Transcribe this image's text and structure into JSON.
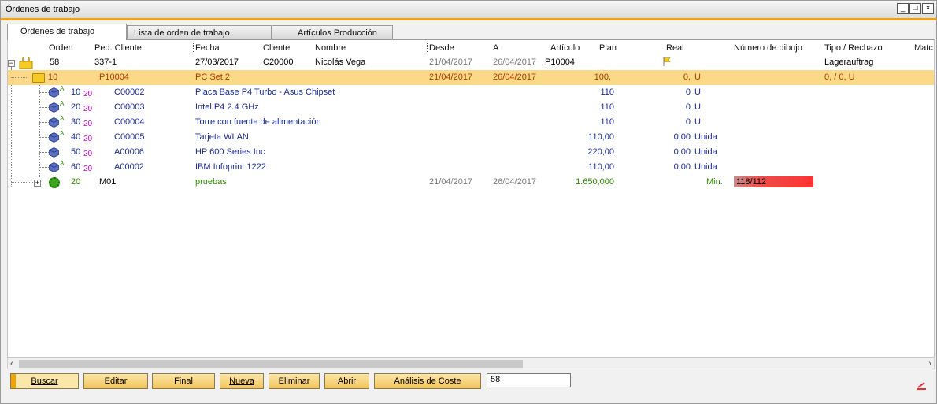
{
  "window": {
    "title": "Órdenes de trabajo",
    "minimize_icon": "minimize-icon",
    "maximize_icon": "maximize-icon",
    "close_icon": "close-icon"
  },
  "tabs": [
    {
      "label": "Órdenes de trabajo",
      "active": true
    },
    {
      "label": "Lista de orden de trabajo",
      "active": false
    },
    {
      "label": "Artículos Producción",
      "active": false
    }
  ],
  "columns": {
    "orden": "Orden",
    "ped_cliente": "Ped. Cliente",
    "fecha": "Fecha",
    "cliente": "Cliente",
    "nombre": "Nombre",
    "desde": "Desde",
    "a": "A",
    "articulo": "Artículo",
    "plan": "Plan",
    "real": "Real",
    "numero_dibujo": "Número de dibujo",
    "tipo_rechazo": "Tipo / Rechazo",
    "matc": "Matc"
  },
  "rows": [
    {
      "orden": "58",
      "ped_cliente": "337-1",
      "fecha": "27/03/2017",
      "cliente": "C20000",
      "nombre": "Nicolás Vega",
      "desde": "21/04/2017",
      "a": "26/04/2017",
      "articulo": "P10004",
      "tipo": "Lagerauftrag",
      "icon": "lock-folder-icon",
      "real_icon": "flag-icon"
    },
    {
      "orden": "10",
      "ped_cliente": "P10004",
      "fecha": "PC Set 2",
      "desde": "21/04/2017",
      "a": "26/04/2017",
      "plan": "100,",
      "real": "0,",
      "unit": "U",
      "tipo": "0, / 0, U",
      "icon": "folder-icon"
    },
    {
      "orden": "10",
      "sub": "20",
      "ped_cliente": "C00002",
      "fecha": "Placa Base P4 Turbo - Asus Chipset",
      "plan": "110",
      "real": "0",
      "unit": "U",
      "icon": "item-cube-icon",
      "marker": "A"
    },
    {
      "orden": "20",
      "sub": "20",
      "ped_cliente": "C00003",
      "fecha": "Intel P4 2.4 GHz",
      "plan": "110",
      "real": "0",
      "unit": "U",
      "icon": "item-cube-icon",
      "marker": "A"
    },
    {
      "orden": "30",
      "sub": "20",
      "ped_cliente": "C00004",
      "fecha": "Torre con fuente de alimentación",
      "plan": "110",
      "real": "0",
      "unit": "U",
      "icon": "item-cube-icon",
      "marker": "A"
    },
    {
      "orden": "40",
      "sub": "20",
      "ped_cliente": "C00005",
      "fecha": "Tarjeta WLAN",
      "plan": "110,00",
      "real": "0,00",
      "unit": "Unida",
      "icon": "item-cube-icon",
      "marker": "A"
    },
    {
      "orden": "50",
      "sub": "20",
      "ped_cliente": "A00006",
      "fecha": "HP 600 Series Inc",
      "plan": "220,00",
      "real": "0,00",
      "unit": "Unida",
      "icon": "item-cube-icon",
      "marker": ""
    },
    {
      "orden": "60",
      "sub": "20",
      "ped_cliente": "A00002",
      "fecha": "IBM Infoprint 1222",
      "plan": "110,00",
      "real": "0,00",
      "unit": "Unida",
      "icon": "item-cube-icon",
      "marker": "A"
    },
    {
      "orden": "20",
      "ped_cliente": "M01",
      "fecha": "pruebas",
      "desde": "21/04/2017",
      "a": "26/04/2017",
      "plan": "1.650,000",
      "unit": "Min.",
      "dibujo": "118/112",
      "icon": "gear-icon"
    }
  ],
  "buttons": {
    "buscar": "Buscar",
    "editar": "Editar",
    "final": "Final",
    "nueva": "Nueva",
    "eliminar": "Eliminar",
    "abrir": "Abrir",
    "analisis": "Análisis de Coste"
  },
  "search_value": "58",
  "colors": {
    "accent": "#f0a30a",
    "selected_row": "#fbd989",
    "item_text": "#1c2a9a",
    "order_text": "#b33a00",
    "routing_text": "#2e8b00",
    "drawing_bar": "#ff3333"
  }
}
